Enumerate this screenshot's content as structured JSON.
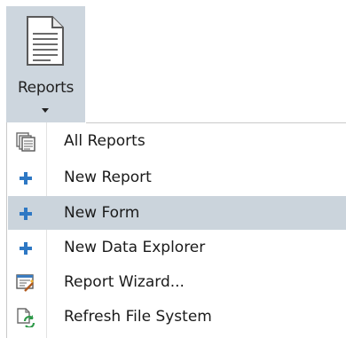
{
  "ribbon": {
    "reports_label": "Reports",
    "icon": "document-icon",
    "dropdown_icon": "caret-down-icon"
  },
  "menu": {
    "items": [
      {
        "label": "All Reports",
        "icon": "report-list-icon",
        "highlighted": false
      },
      {
        "label": "New Report",
        "icon": "plus-icon",
        "highlighted": false
      },
      {
        "label": "New Form",
        "icon": "plus-icon",
        "highlighted": true
      },
      {
        "label": "New Data Explorer",
        "icon": "plus-icon",
        "highlighted": false
      },
      {
        "label": "Report Wizard...",
        "icon": "report-wizard-icon",
        "highlighted": false
      },
      {
        "label": "Refresh File System",
        "icon": "refresh-file-system-icon",
        "highlighted": false
      }
    ]
  },
  "colors": {
    "ribbon_background": "#cdd6de",
    "highlight_background": "#cbd4dc",
    "plus_icon": "#2e78c4"
  }
}
